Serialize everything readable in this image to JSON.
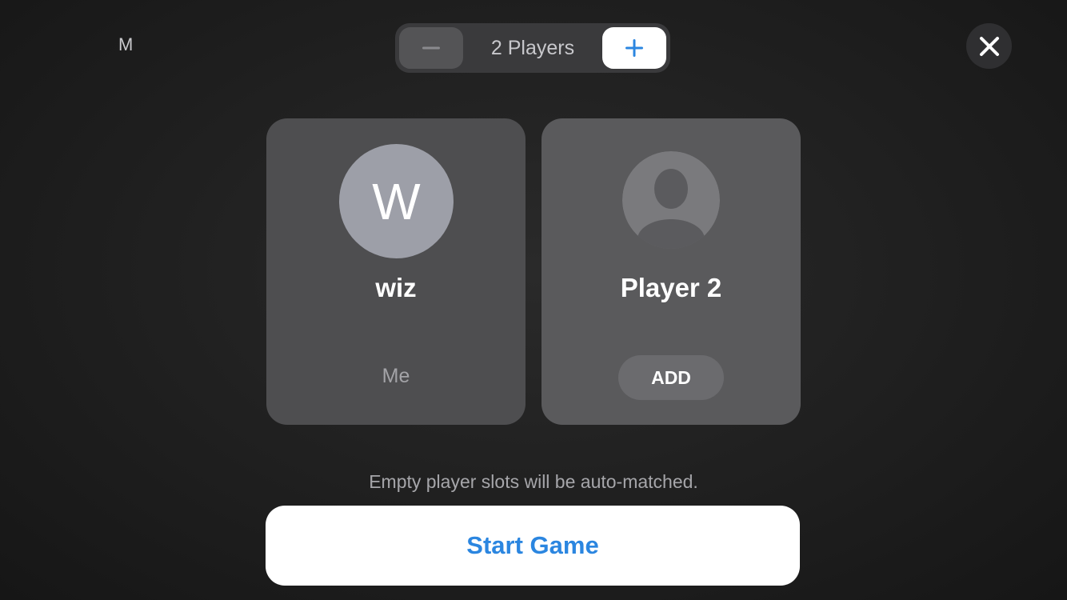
{
  "header": {
    "corner_label": "M",
    "stepper": {
      "minus_icon": "minus-icon",
      "label": "2 Players",
      "plus_icon": "plus-icon"
    },
    "close_icon": "close-icon"
  },
  "players": [
    {
      "avatar_initial": "W",
      "name": "wiz",
      "tag": "Me"
    },
    {
      "avatar_icon": "person-placeholder-icon",
      "name": "Player 2",
      "action_label": "ADD"
    }
  ],
  "hint": "Empty player slots will be auto-matched.",
  "start_button": "Start Game",
  "colors": {
    "accent": "#2b86e0",
    "background": "#222222",
    "card": "#4e4e50"
  }
}
